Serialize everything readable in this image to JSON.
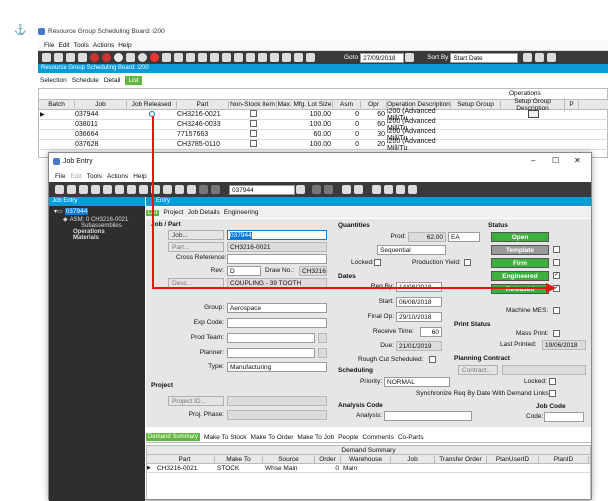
{
  "outer": {
    "title": "Resource Group Scheduling Board: i200",
    "menu": [
      "File",
      "Edit",
      "Tools",
      "Actions",
      "Help"
    ],
    "goto_label": "Goto",
    "goto_value": "27/09/2018",
    "sortby_label": "Sort By",
    "sortby_value": "Start Date",
    "ribbon": "Resource Group Scheduling Board: i200",
    "tabs": [
      "Selection",
      "Schedule",
      "Detail",
      "List"
    ],
    "operations_group": "Operations",
    "columns": [
      "Batch",
      "Job",
      "Job Released",
      "Part",
      "Non-Stock Item",
      "Max. Mfg. Lot Size",
      "Asm",
      "Opr",
      "Operation Description",
      "Setup Group",
      "Setup Group Description",
      "P"
    ],
    "rows": [
      {
        "job": "037944",
        "part": "CH3216-0021",
        "lot": "100.00",
        "asm": "0",
        "opr": "60",
        "desc": "i200 (Advanced Mill/Tu"
      },
      {
        "job": "038011",
        "part": "CH3246-0033",
        "lot": "100.00",
        "asm": "0",
        "opr": "60",
        "desc": "i200 (Advanced Mill/Tu"
      },
      {
        "job": "036664",
        "part": "77157663",
        "lot": "60.00",
        "asm": "0",
        "opr": "30",
        "desc": "i200 (Advanced Mill/Tu"
      },
      {
        "job": "037628",
        "part": "CH3785-0110",
        "lot": "100.00",
        "asm": "0",
        "opr": "20",
        "desc": "i200 (Advanced Mill/Tu"
      }
    ]
  },
  "window": {
    "title": "Job Entry",
    "menu": [
      "File",
      "Edit",
      "Tools",
      "Actions",
      "Help"
    ],
    "job_search": "037944",
    "tree_header": "Job Entry",
    "tree": [
      "037944",
      "ASM: 0 CH3216-0021",
      "Subassemblies",
      "Operations",
      "Materials"
    ],
    "panel_header": "Entry",
    "tabs": [
      "Project",
      "Job Details",
      "Engineering"
    ],
    "job_part": "Job / Part",
    "job_btn": "Job...",
    "job_val": "037944",
    "part_btn": "Part...",
    "part_val": "CH3216-0021",
    "crossref_label": "Cross Reference:",
    "rev_label": "Rev:",
    "rev_val": "D",
    "drawno_label": "Draw No.:",
    "drawno_val": "CH3216-",
    "desc_btn": "Desc...",
    "desc_val": "COUPLING - 39 TOOTH",
    "group_label": "Group:",
    "group_val": "Aerospace",
    "expcode_label": "Exp Code:",
    "prodteam_label": "Prod Team:",
    "planner_label": "Planner:",
    "type_label": "Type:",
    "type_val": "Manufacturing",
    "project_header": "Project",
    "projectid_btn": "Project ID...",
    "projphase_label": "Proj. Phase:",
    "quantities": "Quantities",
    "prod_label": "Prod:",
    "prod_val": "62.00",
    "prod_uom": "EA",
    "mode_label": "Mode:",
    "mode_val": "Sequential",
    "locked_label": "Locked:",
    "prodyield_label": "Production Yield:",
    "dates": "Dates",
    "reqby_label": "Req By:",
    "reqby_val": "14/08/2018",
    "start_label": "Start:",
    "start_val": "06/08/2018",
    "finalop_label": "Final Op:",
    "finalop_val": "29/10/2018",
    "recvtime_label": "Receive Time:",
    "recvtime_val": "60",
    "due_label": "Due:",
    "due_val": "21/01/2019",
    "roughcut_label": "Rough Cut Scheduled:",
    "scheduling": "Scheduling",
    "priority_label": "Priority:",
    "priority_val": "NORMAL",
    "locked2_label": "Locked:",
    "sync_label": "Synchronize Req By Date With Demand Links:",
    "analysis": "Analysis Code",
    "analysis_label": "Analysis:",
    "status": "Status",
    "status_items": [
      {
        "label": "Open",
        "color": "#3cb03c"
      },
      {
        "label": "Template",
        "color": "#9a9a9a"
      },
      {
        "label": "Firm",
        "color": "#3cb03c"
      },
      {
        "label": "Engineered",
        "color": "#3cb03c"
      },
      {
        "label": "Released",
        "color": "#3cb03c"
      }
    ],
    "machinemes_label": "Machine MES:",
    "printstatus": "Print Status",
    "massprint_label": "Mass Print:",
    "lastprinted_label": "Last Printed:",
    "lastprinted_val": "19/06/2018",
    "planningcontract": "Planning Contract",
    "contract_btn": "Contract...",
    "jobcode": "Job Code",
    "code_label": "Code:",
    "bottom_tabs": [
      "Demand Summary",
      "Make To Stock",
      "Make To Order",
      "Make To Job",
      "People",
      "Comments",
      "Co-Parts"
    ],
    "demand_title": "Demand Summary",
    "demand_cols": [
      "Part",
      "Make To",
      "Source",
      "Order",
      "Warehouse",
      "Job",
      "Transfer Order",
      "PlanUserID",
      "PlanID"
    ],
    "demand_row": [
      "CH3216-0021",
      "STOCK",
      "Whse Main",
      "0",
      "Main",
      "",
      "",
      "",
      ""
    ]
  }
}
